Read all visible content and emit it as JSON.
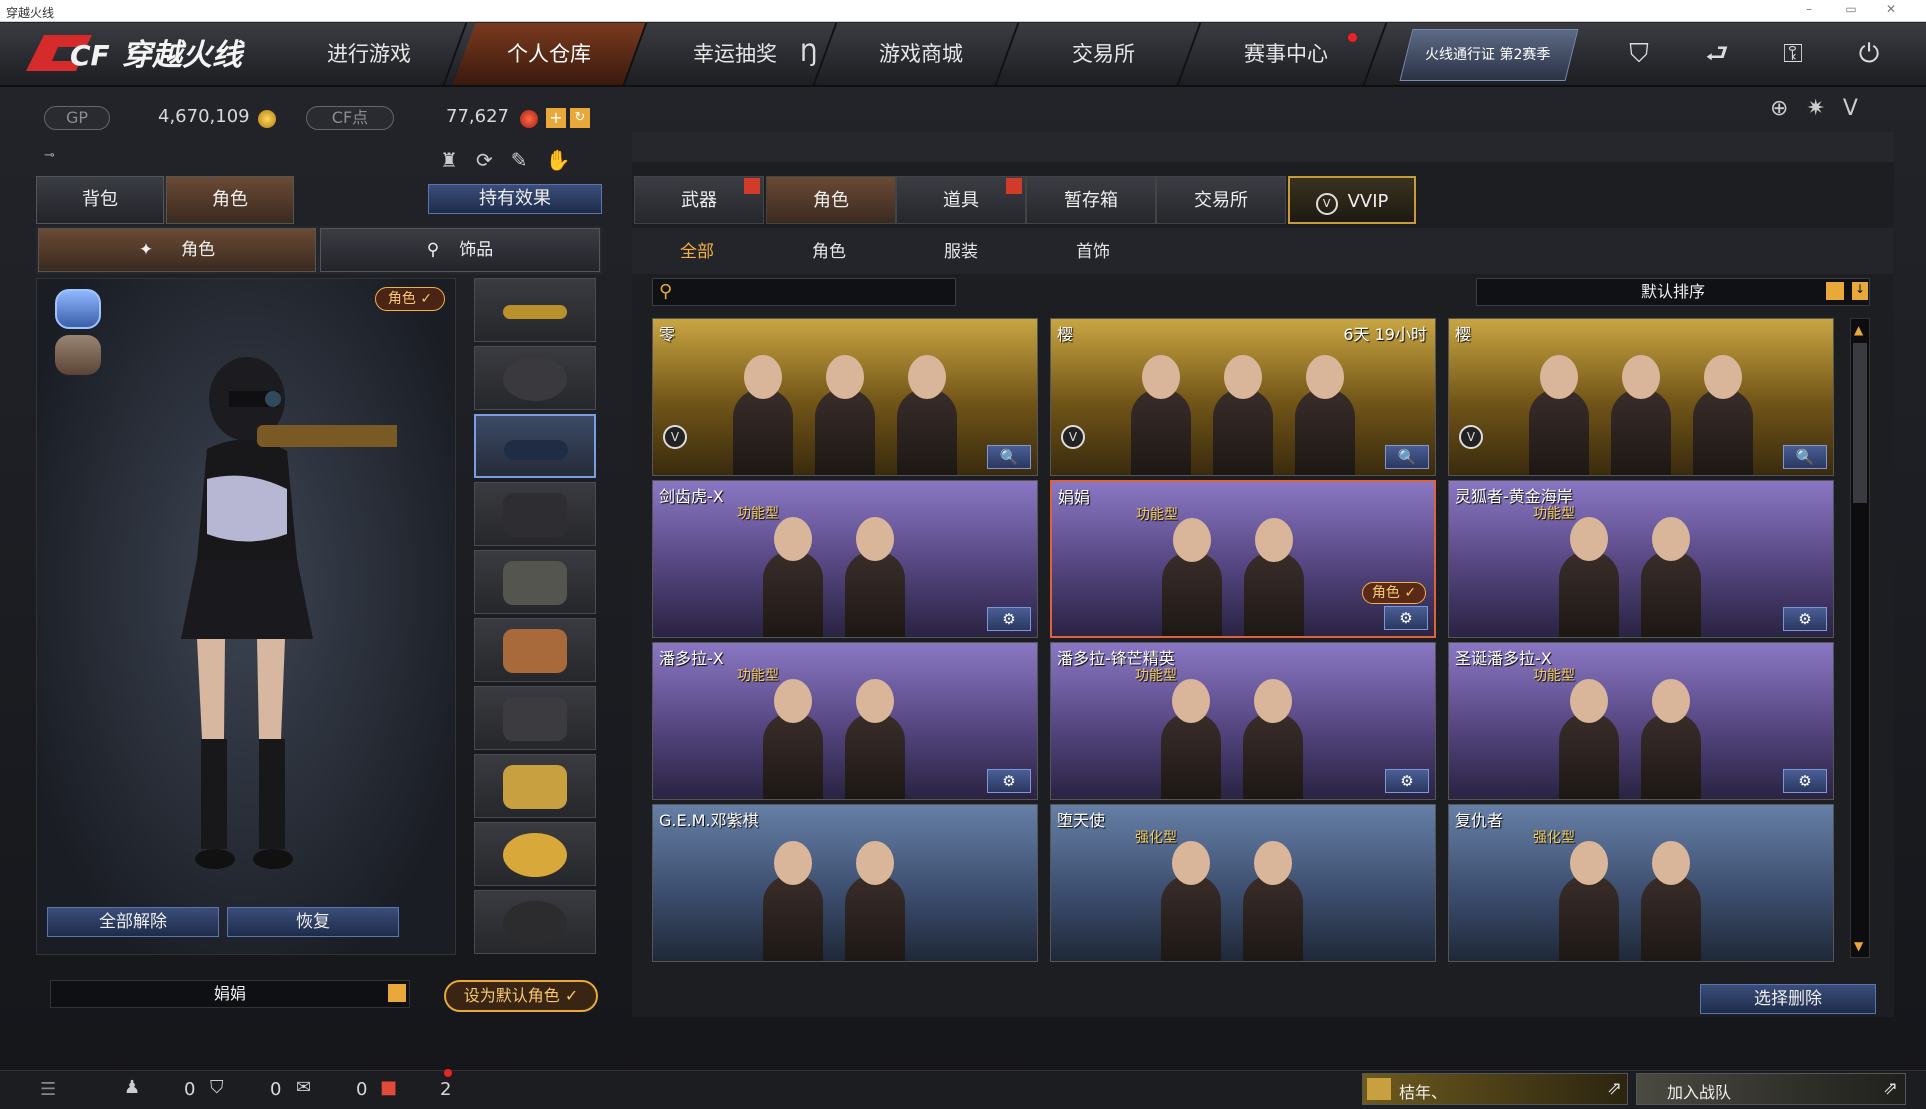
{
  "window": {
    "title": "穿越火线",
    "controls": [
      "–",
      "▭",
      "✕"
    ]
  },
  "logo": {
    "brand": "CF",
    "name": "穿越火线"
  },
  "nav": {
    "items": [
      "进行游戏",
      "个人仓库",
      "幸运抽奖",
      "游戏商城",
      "交易所",
      "赛事中心"
    ],
    "active": "个人仓库",
    "pass": "火线通行证 第2赛季"
  },
  "currency": {
    "gp_label": "GP",
    "gp_value": "4,670,109",
    "cf_label": "CF点",
    "cf_value": "77,627",
    "plus": "+"
  },
  "left": {
    "tabs": [
      "背包",
      "角色"
    ],
    "effect_button": "持有效果",
    "subtabs": [
      "角色",
      "饰品"
    ],
    "role_badge": "角色 ✓",
    "unequip_all": "全部解除",
    "restore": "恢复",
    "character_name": "娟娟",
    "set_default": "设为默认角色 ✓"
  },
  "right": {
    "tabs": [
      "武器",
      "角色",
      "道具",
      "暂存箱",
      "交易所",
      "VVIP"
    ],
    "active_tab": "角色",
    "subtabs": [
      "全部",
      "角色",
      "服装",
      "首饰"
    ],
    "active_subtab": "全部",
    "search_placeholder": "",
    "sort_label": "默认排序",
    "delete_button": "选择删除",
    "cards": [
      {
        "title": "零",
        "type": "",
        "time": "",
        "style": "gold",
        "btn": "🔍",
        "vbadge": "V"
      },
      {
        "title": "樱",
        "type": "",
        "time": "6天 19小时",
        "style": "gold",
        "btn": "🔍",
        "vbadge": "V"
      },
      {
        "title": "樱",
        "type": "",
        "time": "",
        "style": "gold",
        "btn": "🔍",
        "vbadge": "V"
      },
      {
        "title": "剑齿虎-X",
        "type": "功能型",
        "time": "",
        "style": "purple",
        "btn": "⚙"
      },
      {
        "title": "娟娟",
        "type": "功能型",
        "time": "",
        "style": "purple",
        "btn": "⚙",
        "selected": true,
        "badge": "角色 ✓"
      },
      {
        "title": "灵狐者-黄金海岸",
        "type": "功能型",
        "time": "",
        "style": "purple",
        "btn": "⚙"
      },
      {
        "title": "潘多拉-X",
        "type": "功能型",
        "time": "",
        "style": "purple",
        "btn": "⚙"
      },
      {
        "title": "潘多拉-锋芒精英",
        "type": "功能型",
        "time": "",
        "style": "purple",
        "btn": "⚙"
      },
      {
        "title": "圣诞潘多拉-X",
        "type": "功能型",
        "time": "",
        "style": "purple",
        "btn": "⚙"
      },
      {
        "title": "G.E.M.邓紫棋",
        "type": "",
        "time": "",
        "style": "blue"
      },
      {
        "title": "堕天使",
        "type": "强化型",
        "time": "",
        "style": "blue"
      },
      {
        "title": "复仇者",
        "type": "强化型",
        "time": "",
        "style": "blue"
      }
    ]
  },
  "bottom": {
    "counts": [
      "0",
      "0",
      "0",
      "2"
    ],
    "player": "桔年、",
    "team": "加入战队"
  },
  "colors": {
    "accent_orange": "#f2b045",
    "selected_border": "#e0623a",
    "button_blue": "#3b4e7a"
  }
}
